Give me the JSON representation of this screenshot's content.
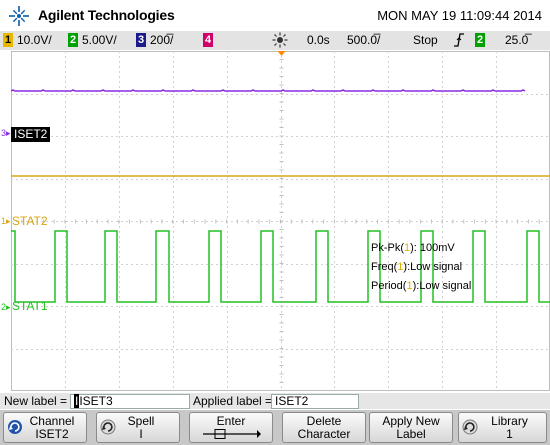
{
  "header": {
    "brand": "Agilent Technologies",
    "datetime": "MON MAY 19 11:09:44 2014"
  },
  "status_bar": {
    "ch1": {
      "num": "1",
      "value": "10.0V/",
      "color": "#e8b800"
    },
    "ch2": {
      "num": "2",
      "value": "5.00V/",
      "color": "#00a000"
    },
    "ch3": {
      "num": "3",
      "value": "200̅/",
      "color": "#1a1a8a"
    },
    "ch4": {
      "num": "4",
      "color": "#d0006a"
    },
    "time_offset": "0.0s",
    "time_div": "500.0̅/",
    "run_state": "Stop",
    "trigger_channel": "2",
    "trigger_level": "25.0̅"
  },
  "traces": {
    "ch3": {
      "label": "ISET2",
      "marker": "3",
      "color": "#8a2be2"
    },
    "ch1": {
      "label": "STAT2",
      "marker": "1",
      "color": "#d9a514"
    },
    "ch2": {
      "label": "STAT1",
      "marker": "2",
      "color": "#22c022"
    }
  },
  "measurements": {
    "pkpk": {
      "prefix": "Pk-Pk(",
      "ch": "1",
      "suffix": "): 100mV"
    },
    "freq": {
      "prefix": "Freq(",
      "ch": "1",
      "suffix": "):Low signal"
    },
    "period": {
      "prefix": "Period(",
      "ch": "1",
      "suffix": "):Low signal"
    }
  },
  "label_bar": {
    "new_label_caption": "New label =",
    "new_label_value": "ISET3",
    "applied_label_caption": "Applied label =",
    "applied_label_value": "ISET2"
  },
  "softkeys": [
    {
      "line1": "Channel",
      "line2": "ISET2"
    },
    {
      "line1": "Spell",
      "line2": "I"
    },
    {
      "line1": "Enter",
      "line2": ""
    },
    {
      "line1": "Delete",
      "line2": "Character"
    },
    {
      "line1": "Apply New",
      "line2": "Label"
    },
    {
      "line1": "Library",
      "line2": "1"
    }
  ]
}
